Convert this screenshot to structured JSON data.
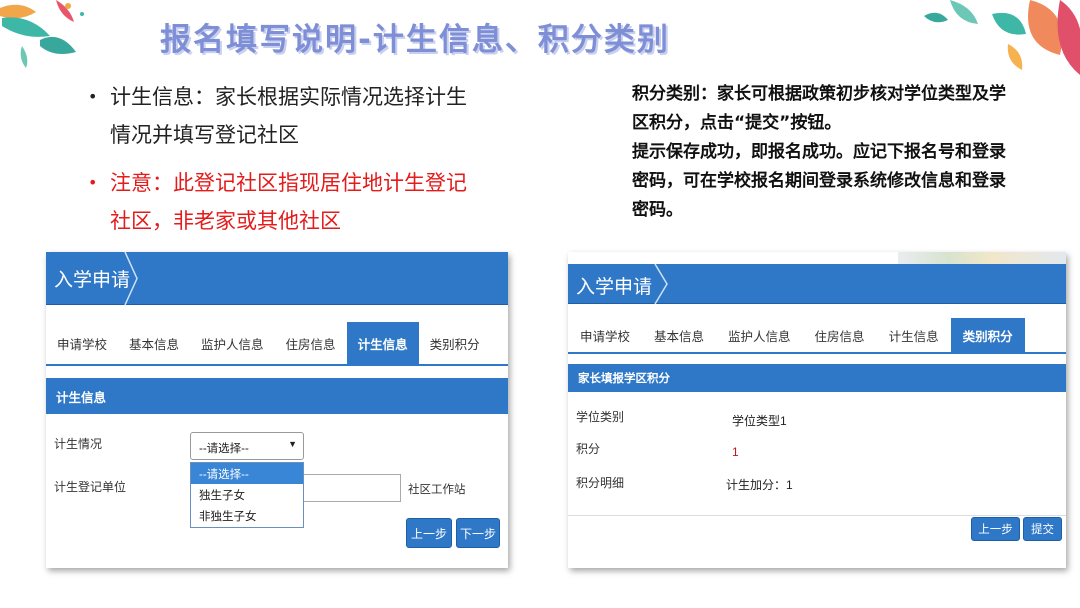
{
  "slide": {
    "title": "报名填写说明-计生信息、积分类别",
    "bullets": [
      {
        "text": "计生信息：家长根据实际情况选择计生情况并填写登记社区",
        "color": "#222222"
      },
      {
        "text": "注意：此登记社区指现居住地计生登记社区，非老家或其他社区",
        "color": "#e31b1b"
      }
    ],
    "right_text": [
      "积分类别：家长可根据政策初步核对学位类型及学区积分，点击“提交”按钮。",
      "提示保存成功，即报名成功。应记下报名号和登录密码，可在学校报名期间登录系统修改信息和登录密码。"
    ]
  },
  "left_panel": {
    "app_title": "入学申请",
    "tabs": [
      "申请学校",
      "基本信息",
      "监护人信息",
      "住房信息",
      "计生信息",
      "类别积分"
    ],
    "active_tab": 4,
    "section_title": "计生信息",
    "fields": {
      "status_label": "计生情况",
      "unit_label": "计生登记单位",
      "select_value": "--请选择--",
      "addon": "社区工作站"
    },
    "dropdown_options": [
      "--请选择--",
      "独生子女",
      "非独生子女"
    ],
    "prev_button": "上一步",
    "next_button": "下一步"
  },
  "right_panel": {
    "app_title": "入学申请",
    "tabs": [
      "申请学校",
      "基本信息",
      "监护人信息",
      "住房信息",
      "计生信息",
      "类别积分"
    ],
    "active_tab": 5,
    "section_title": "家长填报学区积分",
    "rows": [
      {
        "label": "学位类别",
        "value": "学位类型1"
      },
      {
        "label": "积分",
        "value": "1"
      },
      {
        "label": "积分明细",
        "value": "计生加分：1"
      }
    ],
    "prev_button": "上一步",
    "submit_button": "提交"
  },
  "colors": {
    "brand_blue": "#2f78c8",
    "title_purple": "#7f8fd6",
    "warning_red": "#e31b1b"
  }
}
